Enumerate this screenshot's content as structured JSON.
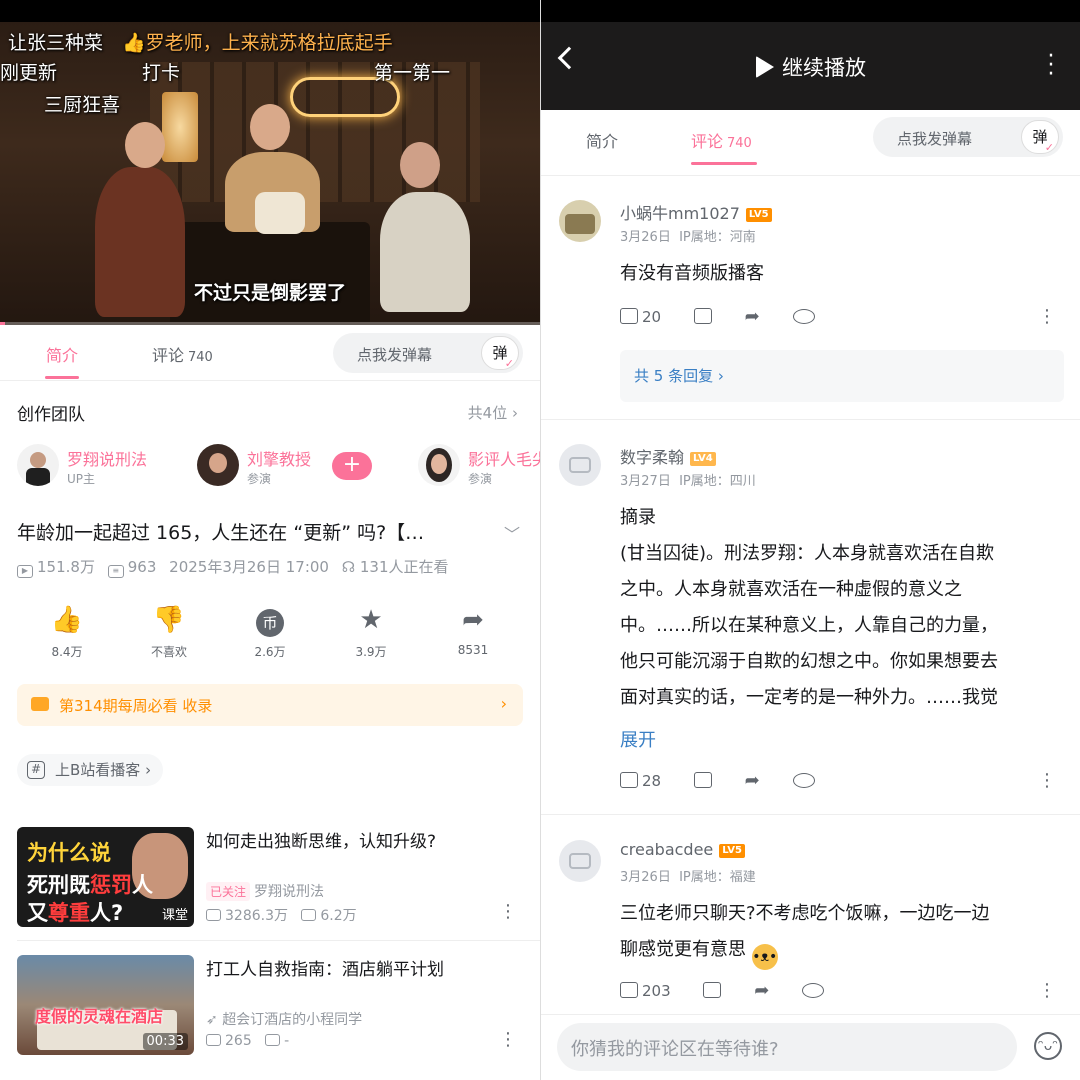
{
  "left": {
    "danmaku": [
      {
        "text": "让张三种菜",
        "color": "#ffffff"
      },
      {
        "text": "👍罗老师，上来就苏格拉底起手",
        "color": "#ffb24d"
      },
      {
        "text": "刚更新",
        "color": "#ffffff"
      },
      {
        "text": "打卡",
        "color": "#ffffff"
      },
      {
        "text": "第一第一",
        "color": "#ffffff"
      },
      {
        "text": "三厨狂喜",
        "color": "#ffffff"
      }
    ],
    "subtitle": "不过只是倒影罢了",
    "progress": 0.01,
    "tabs": {
      "intro": "简介",
      "comments": "评论",
      "comments_count": "740",
      "danmu_placeholder": "点我发弹幕",
      "danmu_button": "弹"
    },
    "team": {
      "title": "创作团队",
      "count": "共4位",
      "members": [
        {
          "name": "罗翔说刑法",
          "role": "UP主"
        },
        {
          "name": "刘擎教授",
          "role": "参演"
        },
        {
          "name": "影评人毛尖",
          "role": "参演"
        }
      ],
      "follow_button": "+"
    },
    "video": {
      "title": "年龄加一起超过 165，人生还在 “更新” 吗?【…",
      "views": "151.8万",
      "danmaku_count": "963",
      "date": "2025年3月26日 17:00",
      "watching": "131人正在看"
    },
    "actions": [
      {
        "icon": "like-icon",
        "label": "8.4万"
      },
      {
        "icon": "dislike-icon",
        "label": "不喜欢"
      },
      {
        "icon": "coin-icon",
        "label": "2.6万"
      },
      {
        "icon": "favorite-icon",
        "label": "3.9万"
      },
      {
        "icon": "share-icon",
        "label": "8531"
      }
    ],
    "weekly": "第314期每周必看 收录",
    "podcast_chip": "上B站看播客",
    "related": [
      {
        "title": "如何走出独断思维，认知升级?",
        "followed": "已关注",
        "uploader": "罗翔说刑法",
        "views": "3286.3万",
        "danmaku": "6.2万",
        "thumb_line1": "为什么说",
        "thumb_line2a": "死刑既",
        "thumb_line2b": "惩罚",
        "thumb_line2c": "人",
        "thumb_line3a": "又",
        "thumb_line3b": "尊重",
        "thumb_line3c": "人?",
        "thumb_tag": "课堂"
      },
      {
        "title": "打工人自救指南：酒店躺平计划",
        "uploader": "超会订酒店的小程同学",
        "views": "265",
        "danmaku": "-",
        "thumb_caption": "度假的灵魂在酒店",
        "duration": "00:33"
      }
    ]
  },
  "right": {
    "header": {
      "resume": "继续播放"
    },
    "tabs": {
      "intro": "简介",
      "comments": "评论",
      "comments_count": "740",
      "danmu_placeholder": "点我发弹幕",
      "danmu_button": "弹"
    },
    "comments": [
      {
        "user": "小蜗牛mm1027",
        "level": "LV5",
        "date": "3月26日",
        "ip": "IP属地：河南",
        "text": "有没有音频版播客",
        "likes": "20",
        "replies": "共 5 条回复"
      },
      {
        "user": "数字柔翰",
        "level": "LV4",
        "date": "3月27日",
        "ip": "IP属地：四川",
        "lines": [
          "摘录",
          "(甘当囚徒)。刑法罗翔：人本身就喜欢活在自欺",
          "之中。人本身就喜欢活在一种虚假的意义之",
          "中。……所以在某种意义上，人靠自己的力量，",
          "他只可能沉溺于自欺的幻想之中。你如果想要去",
          "面对真实的话，一定考的是一种外力。……我觉"
        ],
        "expand": "展开",
        "likes": "28"
      },
      {
        "user": "creabacdee",
        "level": "LV5",
        "date": "3月26日",
        "ip": "IP属地：福建",
        "lines": [
          "三位老师只聊天?不考虑吃个饭嘛，一边吃一边",
          "聊感觉更有意思"
        ],
        "likes": "203"
      }
    ],
    "input_placeholder": "你猜我的评论区在等待谁?"
  },
  "colors": {
    "accent": "#fb7299",
    "link": "#3a7fc4",
    "weekly_bg": "#fff5e6",
    "weekly_text": "#ff8f00"
  }
}
